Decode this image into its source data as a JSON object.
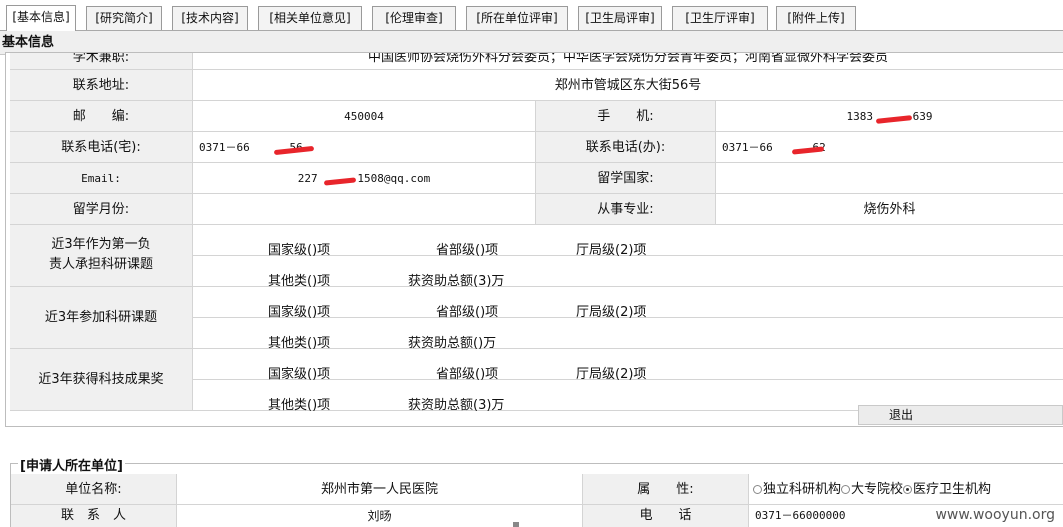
{
  "tabs": [
    {
      "label": "[基本信息]",
      "active": true
    },
    {
      "label": "[研究简介]",
      "active": false
    },
    {
      "label": "[技术内容]",
      "active": false
    },
    {
      "label": "[相关单位意见]",
      "active": false
    },
    {
      "label": "[伦理审查]",
      "active": false
    },
    {
      "label": "[所在单位评审]",
      "active": false
    },
    {
      "label": "[卫生局评审]",
      "active": false
    },
    {
      "label": "[卫生厅评审]",
      "active": false
    },
    {
      "label": "[附件上传]",
      "active": false
    }
  ],
  "section_title": "基本信息",
  "info": {
    "academic_label": "学术兼职:",
    "academic_value": "中国医师协会烧伤外科分会委员；中华医学会烧伤分会青年委员；河南省显微外科学会委员",
    "address_label": "联系地址:",
    "address_value": "郑州市管城区东大街56号",
    "postcode_label": "邮　　编:",
    "postcode_value": "450004",
    "mobile_label": "手　　机:",
    "mobile_value": "1383      639",
    "home_phone_label": "联系电话(宅):",
    "home_phone_value": "0371－66      56",
    "office_phone_label": "联系电话(办):",
    "office_phone_value": "0371－66      62",
    "email_label": "Email:",
    "email_value": "227      1508@qq.com",
    "study_country_label": "留学国家:",
    "study_country_value": "",
    "study_months_label": "留学月份:",
    "study_months_value": "",
    "major_label": "从事专业:",
    "major_value": "烧伤外科"
  },
  "projects": {
    "lead_label": "近3年作为第一负\n责人承担科研课题",
    "lead_national": "国家级()项",
    "lead_provincial": "省部级()项",
    "lead_bureau": "厅局级(2)项",
    "lead_other": "其他类()项",
    "lead_funding": "获资助总额(3)万",
    "join_label": "近3年参加科研课题",
    "join_national": "国家级()项",
    "join_provincial": "省部级()项",
    "join_bureau": "厅局级(2)项",
    "join_other": "其他类()项",
    "join_funding": "获资助总额()万",
    "award_label": "近3年获得科技成果奖",
    "award_national": "国家级()项",
    "award_provincial": "省部级()项",
    "award_bureau": "厅局级(2)项",
    "award_other": "其他类()项",
    "award_funding": "获资助总额(3)万"
  },
  "exit_label": "退出",
  "unit": {
    "legend": "[申请人所在单位]",
    "name_label": "单位名称:",
    "name_value": "郑州市第一人民医院",
    "type_label": "属　　性:",
    "type_options": [
      "独立科研机构",
      "大专院校",
      "医疗卫生机构"
    ],
    "type_selected": "医疗卫生机构",
    "contact_label": "联　系　人",
    "contact_value": "刘旸",
    "phone_label": "电　　话",
    "phone_value": "0371－66000000"
  },
  "watermark": "www.wooyun.org",
  "colors": {
    "redaction": "#e8252b",
    "label_bg": "#f0f0f0",
    "border": "#d4d4d4"
  }
}
